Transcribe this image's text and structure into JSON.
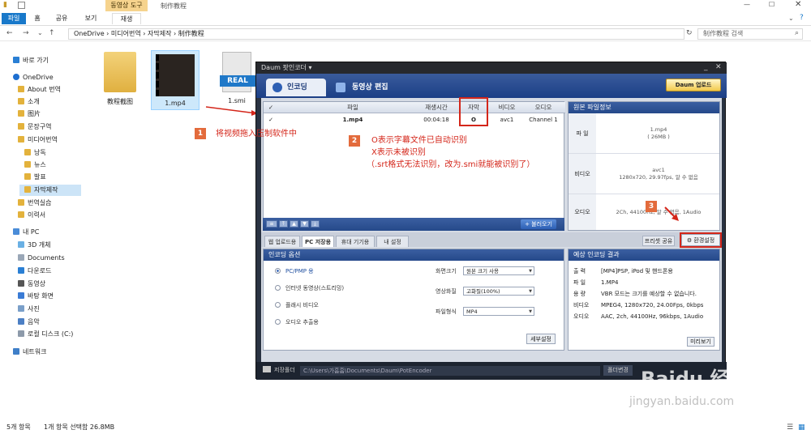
{
  "explorer": {
    "context_tab": "동영상 도구",
    "window_title": "制作教程",
    "tabs": [
      "파일",
      "홈",
      "공유",
      "보기",
      "재생"
    ],
    "path": [
      "OneDrive",
      "미디어번역",
      "자막제작",
      "制作教程"
    ],
    "search_placeholder": "制作教程 검색",
    "sidebar": [
      "바로 가기",
      "OneDrive",
      "About 번역",
      "소개",
      "图片",
      "문장구역",
      "미디어번역",
      "낭독",
      "뉴스",
      "발표",
      "자막제작",
      "번역실습",
      "이력서",
      "내 PC",
      "3D 개체",
      "Documents",
      "다운로드",
      "동영상",
      "바탕 화면",
      "사진",
      "음악",
      "로컬 디스크 (C:)",
      "네트워크"
    ],
    "files": [
      "教程截图",
      "1.mp4",
      "1.smi"
    ],
    "file_badge": "REAL",
    "status_count": "5개 항목",
    "status_selected": "1개 항목 선택함 26.8MB"
  },
  "encoder": {
    "title": "Daum 팟인코더 ▾",
    "tab_encoding": "인코딩",
    "tab_edit": "동영상 편집",
    "upload": "Daum 업로드",
    "columns": [
      "파일",
      "재생시간",
      "자막",
      "비디오",
      "오디오"
    ],
    "row": {
      "file": "1.mp4",
      "duration": "00:04:18",
      "subtitle": "O",
      "video": "avc1",
      "audio": "Channel 1"
    },
    "add_button": "+ 불러오기",
    "orig_header": "원본 파일정보",
    "orig_rows": [
      {
        "label": "파 일",
        "value": [
          "1.mp4",
          "( 26MB )"
        ]
      },
      {
        "label": "비디오",
        "value": [
          "avc1",
          "1280x720, 29.97fps, 알 수 없음"
        ]
      },
      {
        "label": "오디오",
        "value": [
          "2Ch, 44100Hz, 알 수 없음, 1Audio"
        ]
      }
    ],
    "bottom_tabs": [
      "웹 업로드용",
      "PC 저장용",
      "휴대 기기용",
      "내 설정"
    ],
    "preset": "프리셋 공유",
    "env": "환경설정",
    "opt_header": "인코딩 옵션",
    "options": [
      "PC/PMP 용",
      "인터넷 동영상(스트리밍)",
      "플래시 비디오",
      "오디오 추출용"
    ],
    "selects": [
      {
        "label": "화면크기",
        "value": "원본 크기 사용"
      },
      {
        "label": "영상화질",
        "value": "고화질(100%)"
      },
      {
        "label": "파일형식",
        "value": "MP4"
      }
    ],
    "detail": "세부설정",
    "expect_header": "예상 인코딩 결과",
    "expect_rows": [
      {
        "k": "출 력",
        "v": "[MP4]PSP, iPod 및 핸드폰용"
      },
      {
        "k": "파 일",
        "v": "1.MP4"
      },
      {
        "k": "용 량",
        "v": "VBR 모드는 크기를 예상할 수 없습니다."
      },
      {
        "k": "비디오",
        "v": "MPEG4, 1280x720, 24.00Fps, 0kbps"
      },
      {
        "k": "오디오",
        "v": "AAC, 2ch, 44100Hz, 96kbps, 1Audio"
      }
    ],
    "preview": "미리보기",
    "save_label": "저장폴더",
    "save_path": "C:\\Users\\가흠흠\\Documents\\Daum\\PotEncoder",
    "save_btn": "폴더변경"
  },
  "annotations": {
    "n1": "1",
    "t1": "将视频拖入压制软件中",
    "n2": "2",
    "t2a": "O表示字幕文件已自动识别",
    "t2b": "X表示未被识别",
    "t2c": "（.srt格式无法识别，改为.smi就能被识别了）",
    "n3": "3"
  },
  "watermark": {
    "brand": "Baidu 经验",
    "url": "jingyan.baidu.com"
  },
  "colors": {
    "annotation": "#d4261a",
    "badge": "#e36b3c",
    "accent": "#2d5fb4"
  }
}
